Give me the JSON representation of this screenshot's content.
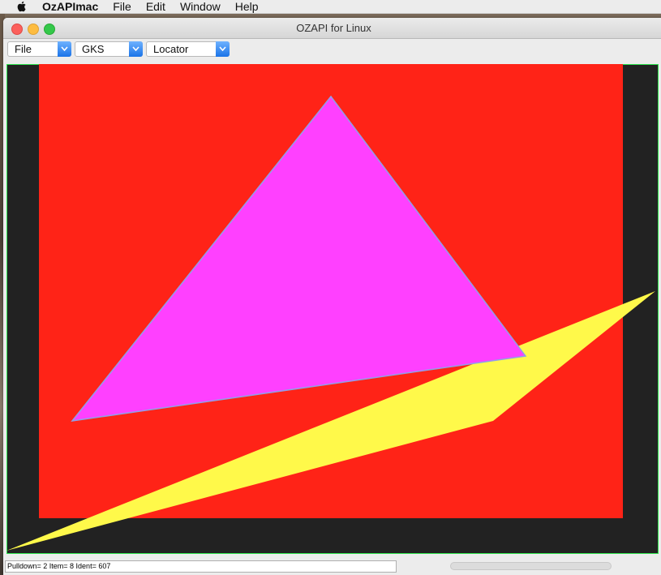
{
  "menubar": {
    "app_name": "OzAPImac",
    "items": [
      "File",
      "Edit",
      "Window",
      "Help"
    ]
  },
  "window": {
    "title": "OZAPI for Linux"
  },
  "toolbar": {
    "file_combo": "File",
    "gks_combo": "GKS",
    "locator_combo": "Locator"
  },
  "status": {
    "text": "Pulldown= 2 Item= 8 Ident=   607"
  },
  "colors": {
    "canvas_bg": "#222222",
    "rect_fill": "#ff2317",
    "triangle_fill": "#ff40ff",
    "triangle_outline": "#8fa0e8",
    "polygon_fill": "#fff94a",
    "frame_border": "#2ee44d",
    "accent": "#1a73e8"
  },
  "icons": [
    "apple-logo-icon",
    "close-window-icon",
    "minimize-window-icon",
    "zoom-window-icon",
    "chevron-down-icon"
  ]
}
